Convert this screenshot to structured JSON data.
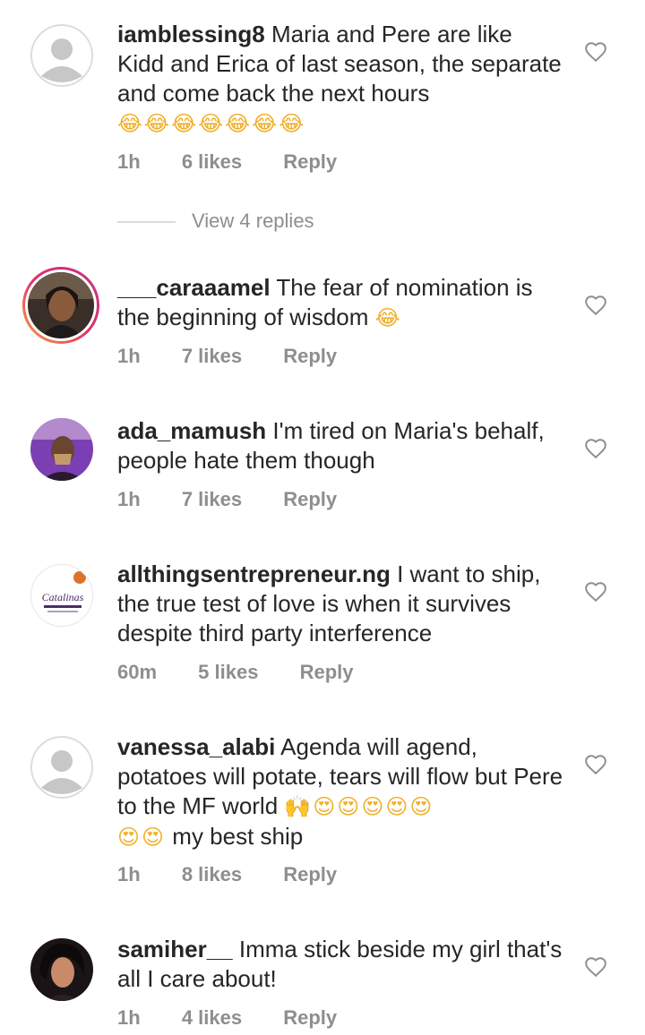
{
  "comments": [
    {
      "username": "iamblessing8",
      "text": "Maria and Pere are like Kidd and  Erica of last season, the separate and come back the next hours",
      "emoji": "😂😂😂😂😂😂😂",
      "time": "1h",
      "likes": "6 likes",
      "reply": "Reply"
    },
    {
      "username": "___caraaamel",
      "text": "The fear of nomination is the beginning of wisdom",
      "emoji": "😂",
      "time": "1h",
      "likes": "7 likes",
      "reply": "Reply"
    },
    {
      "username": "ada_mamush",
      "text": "I'm tired on Maria's behalf, people hate them though",
      "emoji": "",
      "time": "1h",
      "likes": "7 likes",
      "reply": "Reply"
    },
    {
      "username": "allthingsentrepreneur.ng",
      "text": "I want to ship, the true test of love is when it survives despite third party interference",
      "emoji": "",
      "time": "60m",
      "likes": "5 likes",
      "reply": "Reply",
      "avatar_text": "Catalinas"
    },
    {
      "username": "vanessa_alabi",
      "text": "Agenda will agend, potatoes will potate, tears will flow but Pere to the MF world",
      "emoji": "🙌😍😍😍😍😍",
      "emoji2": "😍😍",
      "tail": "my best ship",
      "time": "1h",
      "likes": "8 likes",
      "reply": "Reply"
    },
    {
      "username": "samiher__",
      "text": "Imma stick beside my girl that's all I care about!",
      "emoji": "",
      "time": "1h",
      "likes": "4 likes",
      "reply": "Reply"
    }
  ],
  "view_replies": "View 4 replies",
  "icons": {
    "like": "heart-outline-icon",
    "default_avatar": "default-avatar-icon"
  },
  "colors": {
    "text": "#262626",
    "muted": "#8e8e8e",
    "ring_start": "#f9a13a",
    "ring_end": "#c13584"
  }
}
